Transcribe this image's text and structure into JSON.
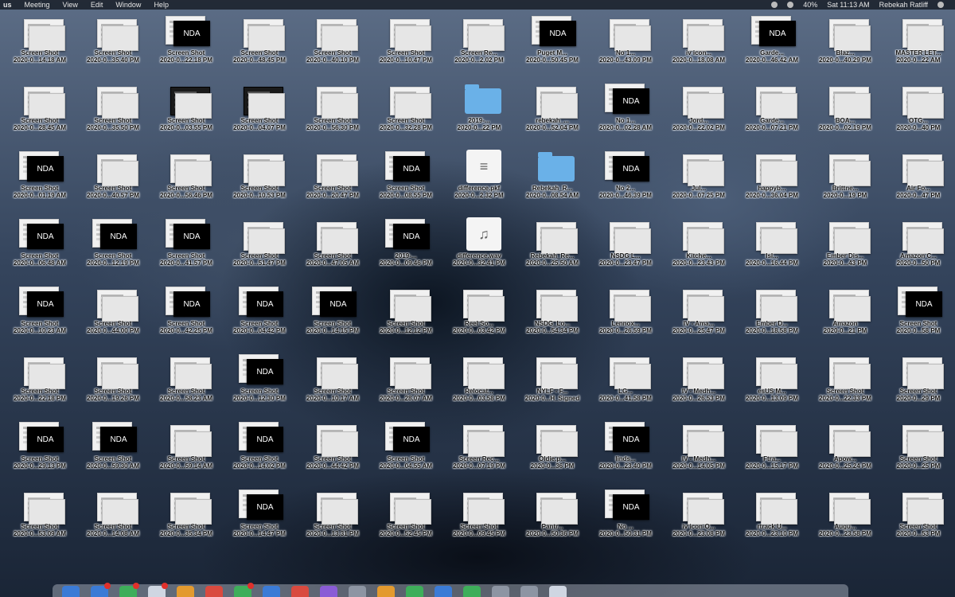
{
  "menubar": {
    "app_fragment": "us",
    "items": [
      "Meeting",
      "View",
      "Edit",
      "Window",
      "Help"
    ],
    "battery": "40%",
    "clock": "Sat 11:13 AM",
    "user": "Rebekah Ratliff"
  },
  "desktop": {
    "nda_text": "NDA",
    "files": [
      {
        "kind": "screenshot",
        "name": "Screen Shot",
        "date": "2020-0...14.18 AM"
      },
      {
        "kind": "screenshot",
        "name": "Screen Shot",
        "date": "2020-0...35.40 PM"
      },
      {
        "kind": "nda",
        "name": "Screen Shot",
        "date": "2020-0...22.18 PM"
      },
      {
        "kind": "screenshot",
        "name": "Screen Shot",
        "date": "2020-0...48.45 PM"
      },
      {
        "kind": "screenshot",
        "name": "Screen Shot",
        "date": "2020-0...40.10 PM"
      },
      {
        "kind": "screenshot",
        "name": "Screen Shot",
        "date": "2020-0...10.47 PM"
      },
      {
        "kind": "screenshot",
        "name": "Screen Re...",
        "date": "2020-0...2.02 PM"
      },
      {
        "kind": "nda",
        "name": "Puget M...",
        "date": "2020-0...50.45 PM"
      },
      {
        "kind": "screenshot",
        "name": "No 1...",
        "date": "2020-0...43.09 PM"
      },
      {
        "kind": "screenshot",
        "name": "iv icon...",
        "date": "2020-0...18.08 AM"
      },
      {
        "kind": "nda",
        "name": "Garde...",
        "date": "2020-0...46.42 AM"
      },
      {
        "kind": "screenshot",
        "name": "Blaz...",
        "date": "2020-0...40.29 PM"
      },
      {
        "kind": "screenshot",
        "name": "MASTER LET...",
        "date": "2020-0...22 AM"
      },
      {
        "kind": "screenshot",
        "name": "Screen Shot",
        "date": "2020-0...28.45 AM"
      },
      {
        "kind": "screenshot",
        "name": "Screen Shot",
        "date": "2020-0...35.50 PM"
      },
      {
        "kind": "dark",
        "name": "Screen Shot",
        "date": "2020-0...03.55 PM"
      },
      {
        "kind": "dark",
        "name": "Screen Shot",
        "date": "2020-0...04.07 PM"
      },
      {
        "kind": "screenshot",
        "name": "Screen Shot",
        "date": "2020-0...56.30 PM"
      },
      {
        "kind": "screenshot",
        "name": "Screen Shot",
        "date": "2020-0...32.28 PM"
      },
      {
        "kind": "folder",
        "name": "2019-...",
        "date": "2020-0...22 PM"
      },
      {
        "kind": "screenshot",
        "name": "rebekah_...",
        "date": "2020-0...52.04 PM"
      },
      {
        "kind": "nda",
        "name": "No 1...",
        "date": "2020-0...02.28 AM"
      },
      {
        "kind": "screenshot",
        "name": "Jord...",
        "date": "2020-0...22.02 PM"
      },
      {
        "kind": "screenshot",
        "name": "Garde...",
        "date": "2020-0...07.21 PM"
      },
      {
        "kind": "screenshot",
        "name": "BOA...",
        "date": "2020-0...02.19 PM"
      },
      {
        "kind": "screenshot",
        "name": "OTG...",
        "date": "2020-0...40 PM"
      },
      {
        "kind": "nda",
        "name": "Screen Shot",
        "date": "2020-0...01.19 AM"
      },
      {
        "kind": "screenshot",
        "name": "Screen Shot",
        "date": "2020-0...40.57 PM"
      },
      {
        "kind": "screenshot",
        "name": "Screen Shot",
        "date": "2020-0...56.46 PM"
      },
      {
        "kind": "screenshot",
        "name": "Screen Shot",
        "date": "2020-0...10.53 PM"
      },
      {
        "kind": "screenshot",
        "name": "Screen Shot",
        "date": "2020-0...20.47 PM"
      },
      {
        "kind": "nda",
        "name": "Screen Shot",
        "date": "2020-0...08.55 PM"
      },
      {
        "kind": "pkf",
        "name": "difference.pkf",
        "date": "2020-0...2.32 PM"
      },
      {
        "kind": "folder",
        "name": "Rebekah_R...",
        "date": "2020-0...08.54 AM"
      },
      {
        "kind": "nda",
        "name": "No 2...",
        "date": "2020-0...46.39 PM"
      },
      {
        "kind": "screenshot",
        "name": "Jul...",
        "date": "2020-0...07.25 PM"
      },
      {
        "kind": "screenshot",
        "name": "happyb...",
        "date": "2020-0...36.04 PM"
      },
      {
        "kind": "screenshot",
        "name": "Brittne...",
        "date": "2020-0...19 PM"
      },
      {
        "kind": "screenshot",
        "name": "Air Fo...",
        "date": "2020-0...47 PM"
      },
      {
        "kind": "nda",
        "name": "Screen Shot",
        "date": "2020-0...06.48 AM"
      },
      {
        "kind": "nda",
        "name": "Screen Shot",
        "date": "2020-0...12.19 PM"
      },
      {
        "kind": "nda",
        "name": "Screen Shot",
        "date": "2020-0...41.57 PM"
      },
      {
        "kind": "screenshot",
        "name": "Screen Shot",
        "date": "2020-0...51.47 PM"
      },
      {
        "kind": "screenshot",
        "name": "Screen Shot",
        "date": "2020-0...47.05 AM"
      },
      {
        "kind": "nda",
        "name": "2019-...",
        "date": "2020-0...09.46 PM"
      },
      {
        "kind": "audio",
        "name": "difference.wav",
        "date": "2020-0...32.41 PM"
      },
      {
        "kind": "screenshot",
        "name": "Rebekah_Re...",
        "date": "2020-0...25.50 AM"
      },
      {
        "kind": "screenshot",
        "name": "NSDG L...",
        "date": "2020-0...23.47 PM"
      },
      {
        "kind": "screenshot",
        "name": "Kitche...",
        "date": "2020-0...23.43 PM"
      },
      {
        "kind": "screenshot",
        "name": "Isl...",
        "date": "2020-0...16.44 PM"
      },
      {
        "kind": "screenshot",
        "name": "Ember Dis...",
        "date": "2020-0...43 PM"
      },
      {
        "kind": "screenshot",
        "name": "Amazon C...",
        "date": "2020-0...50 PM"
      },
      {
        "kind": "nda",
        "name": "Screen Shot",
        "date": "2020-0...10.23 AM"
      },
      {
        "kind": "screenshot",
        "name": "Screen Shot",
        "date": "2020-0...44.00 PM"
      },
      {
        "kind": "nda",
        "name": "Screen Shot",
        "date": "2020-0...42.25 PM"
      },
      {
        "kind": "nda",
        "name": "Screen Shot",
        "date": "2020-0...04.42 PM"
      },
      {
        "kind": "nda",
        "name": "Screen Shot",
        "date": "2020-0...14.15 PM"
      },
      {
        "kind": "screenshot",
        "name": "Screen Shot",
        "date": "2020-0...12.12 PM"
      },
      {
        "kind": "screenshot",
        "name": "Reel So...",
        "date": "2020-0...03.42 PM"
      },
      {
        "kind": "screenshot",
        "name": "NSDG_Lo...",
        "date": "2020-0...54.34 PM"
      },
      {
        "kind": "screenshot",
        "name": "Lennox...",
        "date": "2020-0...26.59 PM"
      },
      {
        "kind": "screenshot",
        "name": "IV - Ama...",
        "date": "2020-0...25.47 PM"
      },
      {
        "kind": "screenshot",
        "name": "Ember D...",
        "date": "2020-0...18.58 PM"
      },
      {
        "kind": "screenshot",
        "name": "Amazon",
        "date": "2020-0...21 PM"
      },
      {
        "kind": "nda",
        "name": "Screen Shot",
        "date": "2020-0...58 PM"
      },
      {
        "kind": "screenshot",
        "name": "Screen Shot",
        "date": "2020-0...22.18 PM"
      },
      {
        "kind": "screenshot",
        "name": "Screen Shot",
        "date": "2020-0...19.26 PM"
      },
      {
        "kind": "screenshot",
        "name": "Screen Shot",
        "date": "2020-0...58.23 AM"
      },
      {
        "kind": "nda",
        "name": "Screen Shot",
        "date": "2020-0...12.30 PM"
      },
      {
        "kind": "screenshot",
        "name": "Screen Shot",
        "date": "2020-0...10.17 AM"
      },
      {
        "kind": "screenshot",
        "name": "Screen Shot",
        "date": "2020-0...28.07 AM"
      },
      {
        "kind": "screenshot",
        "name": "Relocat...",
        "date": "2020-0...03.58 PM"
      },
      {
        "kind": "screenshot",
        "name": "NYLF - F...",
        "date": "2020-0...H_Signed"
      },
      {
        "kind": "screenshot",
        "name": "LG...",
        "date": "2020-0...41.58 PM"
      },
      {
        "kind": "screenshot",
        "name": "IV - Medh...",
        "date": "2020-0...26.53 PM"
      },
      {
        "kind": "screenshot",
        "name": "esUS M...",
        "date": "2020-0...13.09 PM"
      },
      {
        "kind": "screenshot",
        "name": "Screen Shot",
        "date": "2020-0...22.33 PM"
      },
      {
        "kind": "screenshot",
        "name": "Screen Shot",
        "date": "2020-0...29 PM"
      },
      {
        "kind": "nda",
        "name": "Screen Shot",
        "date": "2020-0...29.13 PM"
      },
      {
        "kind": "nda",
        "name": "Screen Shot",
        "date": "2020-0...59.30 AM"
      },
      {
        "kind": "screenshot",
        "name": "Screen Shot",
        "date": "2020-0...59.14 AM"
      },
      {
        "kind": "nda",
        "name": "Screen Shot",
        "date": "2020-0...14.02 PM"
      },
      {
        "kind": "screenshot",
        "name": "Screen Shot",
        "date": "2020-0...44.42 PM"
      },
      {
        "kind": "nda",
        "name": "Screen Shot",
        "date": "2020-0...04.55 AM"
      },
      {
        "kind": "screenshot",
        "name": "Screen Rec...",
        "date": "2020-0...07.19 PM"
      },
      {
        "kind": "screenshot",
        "name": "Oldie.p...",
        "date": "2020-0...36 PM"
      },
      {
        "kind": "nda",
        "name": "linds...",
        "date": "2020-0...23.40 PM"
      },
      {
        "kind": "screenshot",
        "name": "IV - Medh...",
        "date": "2020-0...14.05 PM"
      },
      {
        "kind": "screenshot",
        "name": "Ftra...",
        "date": "2020-0...15.17 PM"
      },
      {
        "kind": "screenshot",
        "name": "Apow...",
        "date": "2020-0...25.24 PM"
      },
      {
        "kind": "screenshot",
        "name": "Screen Shot",
        "date": "2020-0...25 PM"
      },
      {
        "kind": "screenshot",
        "name": "Screen Shot",
        "date": "2020-0...53.09 AM"
      },
      {
        "kind": "screenshot",
        "name": "Screen Shot",
        "date": "2020-0...14.08 AM"
      },
      {
        "kind": "screenshot",
        "name": "Screen Shot",
        "date": "2020-0...35.34 PM"
      },
      {
        "kind": "nda",
        "name": "Screen Shot",
        "date": "2020-0...14.47 PM"
      },
      {
        "kind": "screenshot",
        "name": "Screen Shot",
        "date": "2020-0...13.31 PM"
      },
      {
        "kind": "screenshot",
        "name": "Screen Shot",
        "date": "2020-0...52.45 PM"
      },
      {
        "kind": "screenshot",
        "name": "Screen Shot",
        "date": "2020-0...09.45 PM"
      },
      {
        "kind": "screenshot",
        "name": "Pantr...",
        "date": "2020-0...50.36 PM"
      },
      {
        "kind": "nda",
        "name": "No ...",
        "date": "2020-0...50.31 PM"
      },
      {
        "kind": "screenshot",
        "name": "iv icon-O...",
        "date": "2020-0...23.08 PM"
      },
      {
        "kind": "screenshot",
        "name": "rtrack U...",
        "date": "2020-0...23.10 PM"
      },
      {
        "kind": "screenshot",
        "name": "Augu...",
        "date": "2020-0...23.58 PM"
      },
      {
        "kind": "screenshot",
        "name": "Screen Shot",
        "date": "2020-0...53 PM"
      }
    ]
  },
  "dock": {
    "icons": [
      {
        "name": "finder-icon",
        "color": "#3b7bd6",
        "badge": false
      },
      {
        "name": "mail-icon",
        "color": "#3b7bd6",
        "badge": true
      },
      {
        "name": "messages-icon",
        "color": "#3eae5a",
        "badge": true
      },
      {
        "name": "photos-icon",
        "color": "#cfd6e2",
        "badge": true
      },
      {
        "name": "calendar-icon",
        "color": "#e39a2f",
        "badge": false
      },
      {
        "name": "chrome-icon",
        "color": "#d94a3f",
        "badge": false
      },
      {
        "name": "slack-icon",
        "color": "#3eae5a",
        "badge": true
      },
      {
        "name": "zoom-icon",
        "color": "#3b7bd6",
        "badge": false
      },
      {
        "name": "music-icon",
        "color": "#d94a3f",
        "badge": false
      },
      {
        "name": "podcasts-icon",
        "color": "#8a5cd6",
        "badge": false
      },
      {
        "name": "settings-icon",
        "color": "#8d95a3",
        "badge": false
      },
      {
        "name": "notes-icon",
        "color": "#e39a2f",
        "badge": false
      },
      {
        "name": "numbers-icon",
        "color": "#3eae5a",
        "badge": false
      },
      {
        "name": "appstore-icon",
        "color": "#3b7bd6",
        "badge": false
      },
      {
        "name": "spotify-icon",
        "color": "#3eae5a",
        "badge": false
      },
      {
        "name": "safari-icon",
        "color": "#8d95a3",
        "badge": false
      },
      {
        "name": "terminal-icon",
        "color": "#8d95a3",
        "badge": false
      },
      {
        "name": "trash-icon",
        "color": "#cfd6e2",
        "badge": false
      }
    ]
  }
}
